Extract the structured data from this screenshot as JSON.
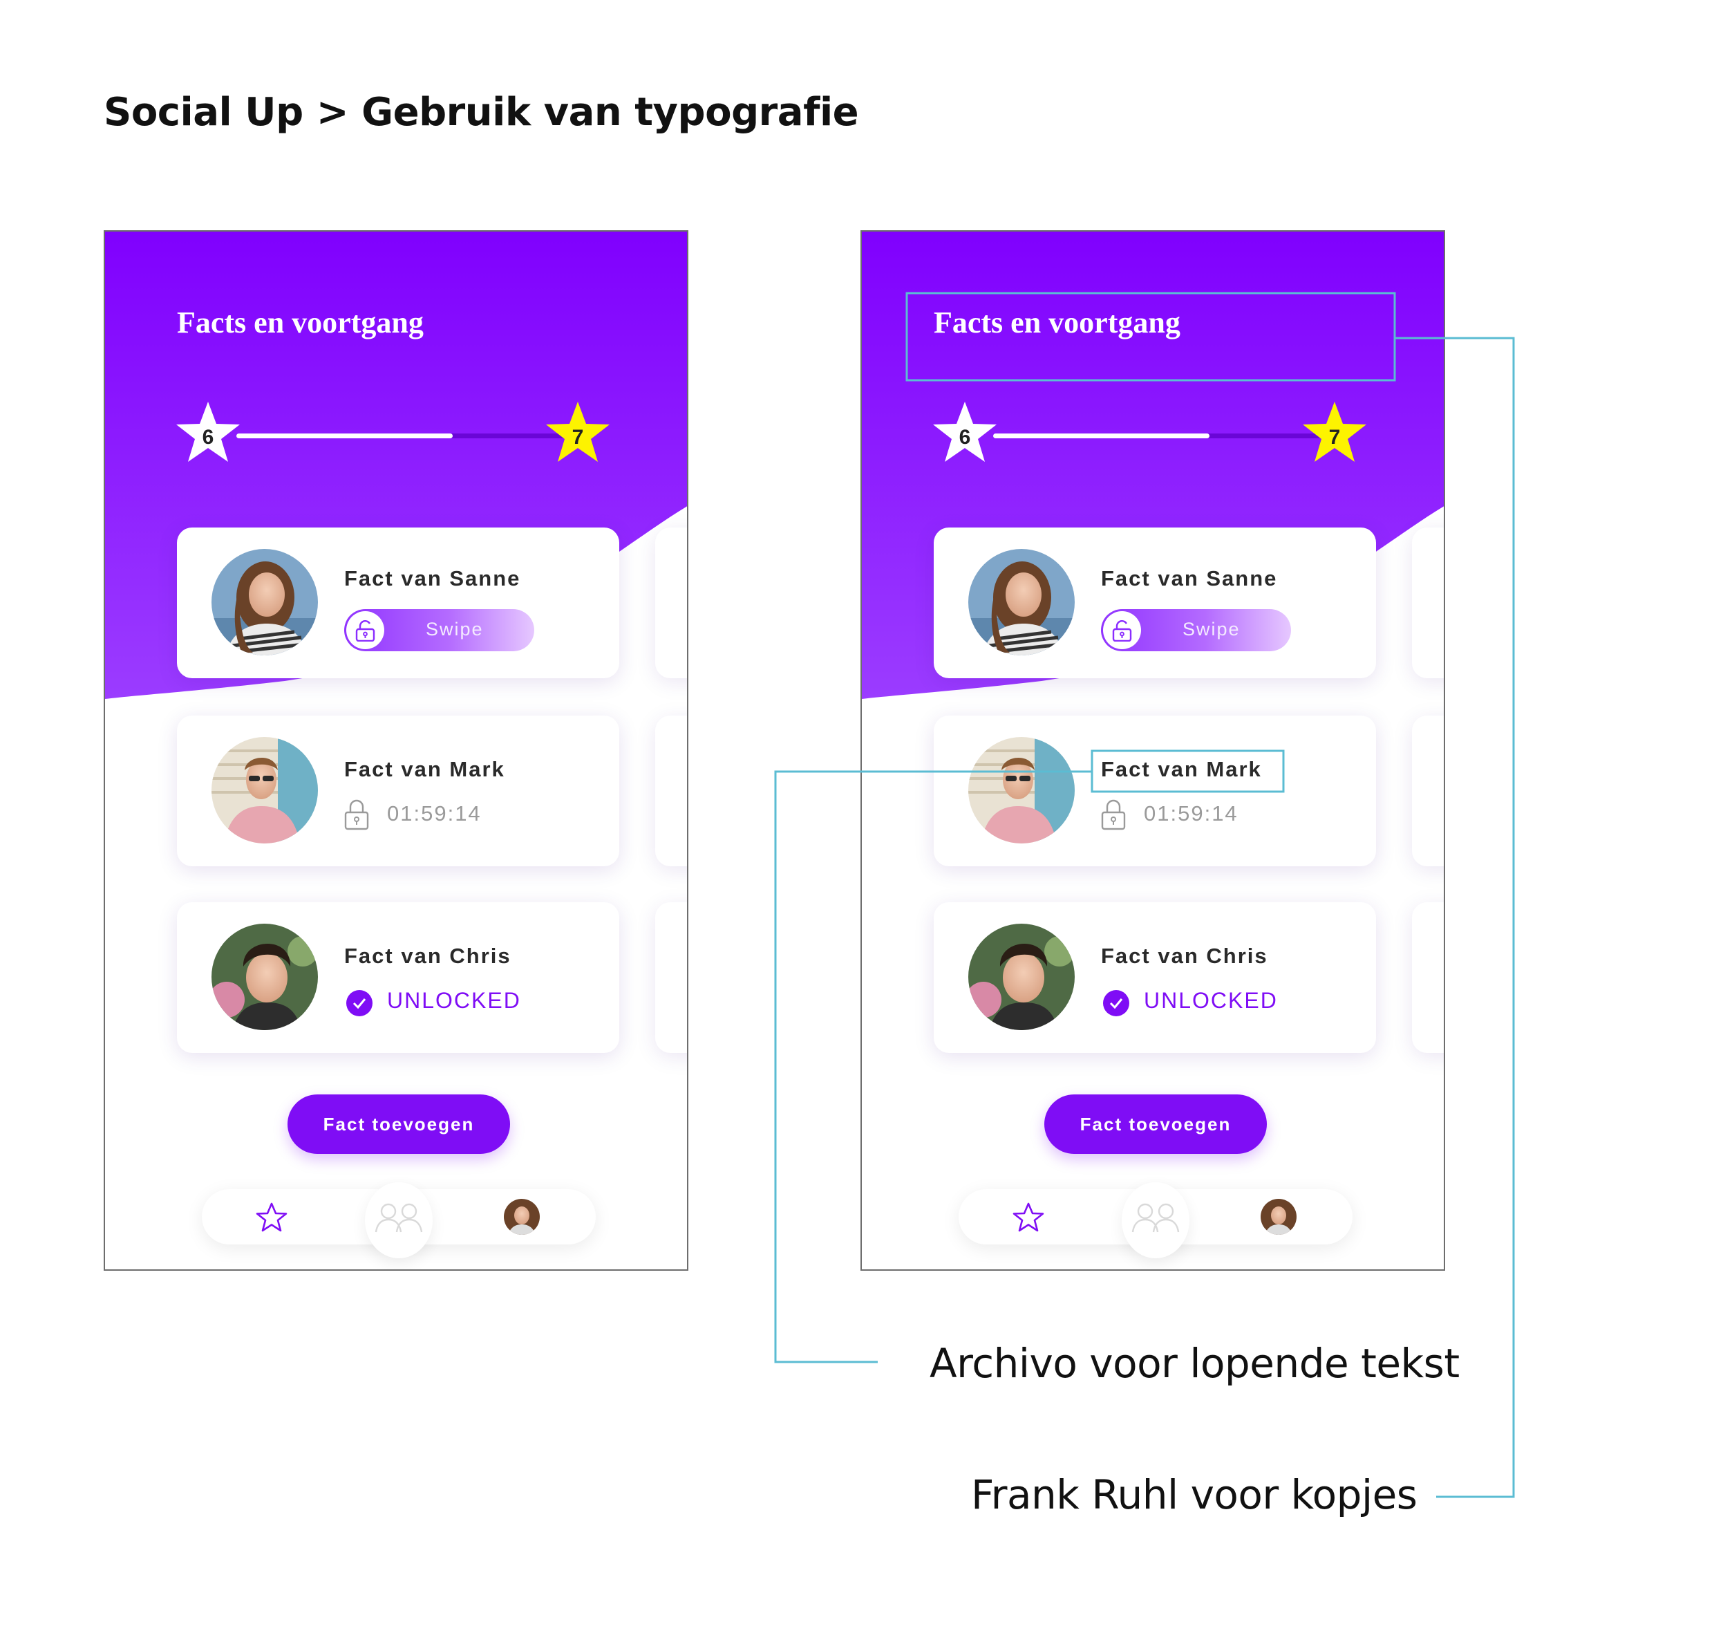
{
  "page": {
    "title": "Social Up > Gebruik van typografie"
  },
  "app": {
    "header_title": "Facts en voortgang",
    "progress": {
      "current_level": "6",
      "next_level": "7",
      "fraction": 0.62
    },
    "facts": [
      {
        "title": "Fact van Sanne",
        "state": "swipe",
        "swipe_label": "Swipe"
      },
      {
        "title": "Fact van Mark",
        "state": "locked",
        "timer": "01:59:14"
      },
      {
        "title": "Fact van Chris",
        "state": "unlocked",
        "status": "UNLOCKED"
      }
    ],
    "add_button": "Fact toevoegen",
    "nav_icons": [
      "star-icon",
      "people-icon",
      "profile-avatar"
    ]
  },
  "annotations": {
    "body_font": "Archivo voor lopende tekst",
    "heading_font": "Frank Ruhl voor kopjes"
  },
  "colors": {
    "brand_purple": "#7f0df5",
    "gradient_top": "#8000fe",
    "gradient_bottom": "#9b3cff",
    "level_star": "#fdf300",
    "annotation_line": "#5bbcd3"
  }
}
